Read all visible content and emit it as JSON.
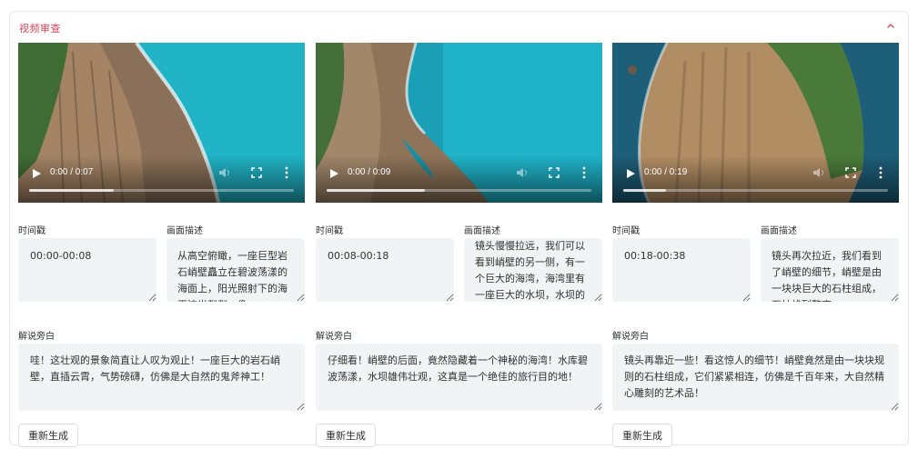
{
  "panel": {
    "title": "视频审查",
    "accent_color": "#e0435a",
    "toggle_icon": "chevron-up-icon"
  },
  "labels": {
    "timestamp": "时间戳",
    "description": "画面描述",
    "narration": "解说旁白",
    "regenerate": "重新生成"
  },
  "clips": [
    {
      "time_display": "0:00 / 0:07",
      "progress": 0.32,
      "timestamp": "00:00-00:08",
      "description": "从高空俯瞰，一座巨型岩石峭壁矗立在碧波荡漾的海面上，阳光照射下的海面波光粼粼，像",
      "narration": "哇！这壮观的景象简直让人叹为观止！一座巨大的岩石峭壁，直插云霄，气势磅礴，仿佛是大自然的鬼斧神工！"
    },
    {
      "time_display": "0:00 / 0:09",
      "progress": 0.37,
      "timestamp": "00:08-00:18",
      "description": "镜头慢慢拉远，我们可以看到峭壁的另一侧，有一个巨大的海湾，海湾里有一座巨大的水坝，水坝的后面是一片",
      "narration": "仔细看！峭壁的后面，竟然隐藏着一个神秘的海湾！水库碧波荡漾，水坝雄伟壮观，这真是一个绝佳的旅行目的地！"
    },
    {
      "time_display": "0:00 / 0:19",
      "progress": 0.16,
      "timestamp": "00:18-00:38",
      "description": "镜头再次拉近，我们看到了峭壁的细节，峭壁是由一块块巨大的石柱组成，石柱排列整齐",
      "narration": "镜头再靠近一些！看这惊人的细节！峭壁竟然是由一块块规则的石柱组成，它们紧紧相连，仿佛是千百年来，大自然精心雕刻的艺术品！"
    }
  ]
}
